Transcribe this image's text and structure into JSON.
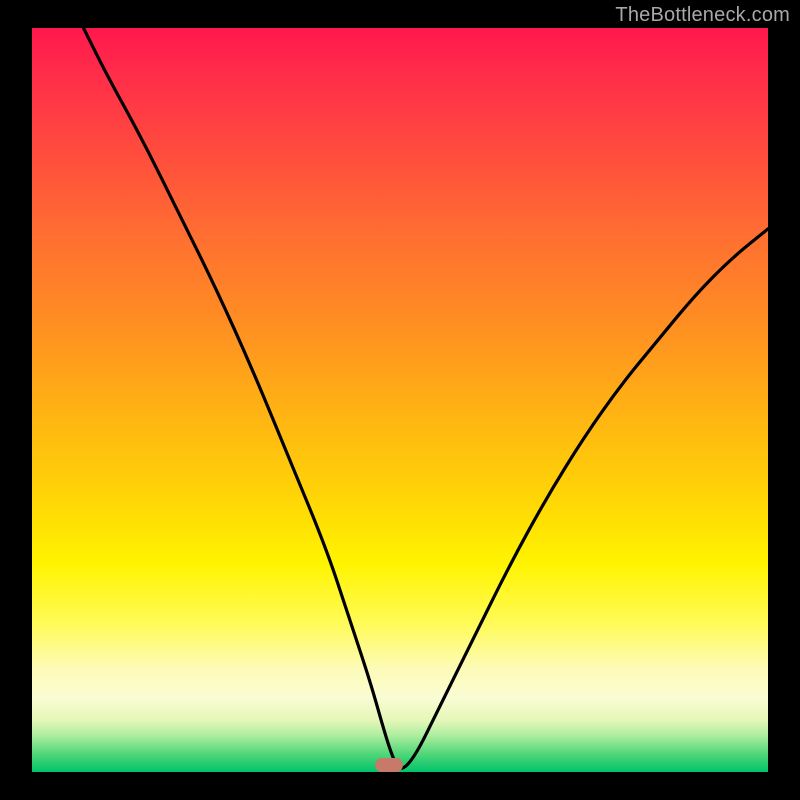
{
  "watermark": "TheBottleneck.com",
  "marker": {
    "x_pct": 48.5,
    "y_pct": 99.0
  },
  "chart_data": {
    "type": "line",
    "title": "",
    "xlabel": "",
    "ylabel": "",
    "xlim": [
      0,
      100
    ],
    "ylim": [
      0,
      100
    ],
    "series": [
      {
        "name": "curve",
        "x": [
          7,
          10,
          15,
          20,
          25,
          30,
          35,
          40,
          43,
          46,
          48,
          49,
          50,
          52,
          55,
          60,
          65,
          70,
          75,
          80,
          85,
          90,
          95,
          100
        ],
        "y": [
          100,
          94,
          85,
          75,
          65,
          54,
          42,
          30,
          21,
          12,
          5,
          2,
          0,
          2,
          8,
          18,
          28,
          37,
          45,
          52,
          58,
          64,
          69,
          73
        ]
      }
    ],
    "annotations": [
      {
        "type": "marker",
        "x": 49,
        "y": 1,
        "shape": "pill",
        "color": "#c77a6a"
      }
    ],
    "background_gradient": {
      "top": "#ff184e",
      "bottom": "#00c36a",
      "stops": [
        "red",
        "orange",
        "yellow",
        "pale-yellow",
        "green"
      ]
    }
  }
}
